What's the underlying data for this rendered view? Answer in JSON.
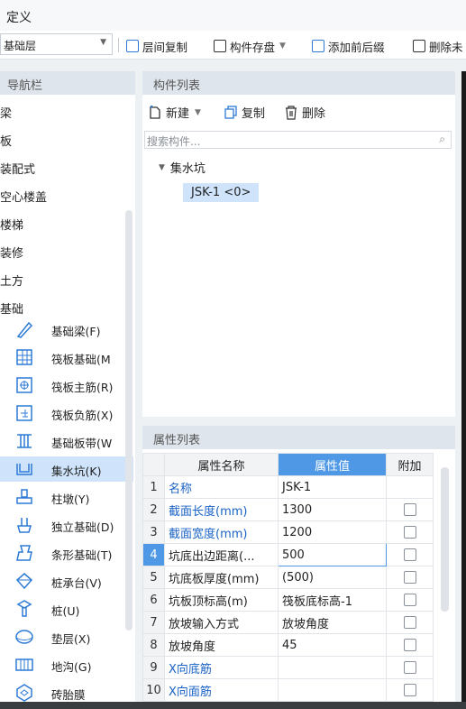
{
  "menu": {
    "title": "定义"
  },
  "toolbar": {
    "layer": "基础层",
    "buttons": [
      "层间复制",
      "构件存盘",
      "添加前后缀",
      "删除未"
    ]
  },
  "nav": {
    "title": "导航栏",
    "categories": [
      "梁",
      "板",
      "装配式",
      "空心楼盖",
      "楼梯",
      "装修",
      "土方",
      "基础"
    ],
    "subitems": [
      {
        "label": "基础梁(F)",
        "icon": "foundation-beam-icon"
      },
      {
        "label": "筏板基础(M",
        "icon": "raft-foundation-icon"
      },
      {
        "label": "筏板主筋(R)",
        "icon": "raft-main-rebar-icon"
      },
      {
        "label": "筏板负筋(X)",
        "icon": "raft-negative-rebar-icon"
      },
      {
        "label": "基础板带(W",
        "icon": "foundation-strip-icon"
      },
      {
        "label": "集水坑(K)",
        "icon": "sump-pit-icon"
      },
      {
        "label": "柱墩(Y)",
        "icon": "column-pier-icon"
      },
      {
        "label": "独立基础(D)",
        "icon": "isolated-footing-icon"
      },
      {
        "label": "条形基础(T)",
        "icon": "strip-footing-icon"
      },
      {
        "label": "桩承台(V)",
        "icon": "pile-cap-icon"
      },
      {
        "label": "桩(U)",
        "icon": "pile-icon"
      },
      {
        "label": "垫层(X)",
        "icon": "cushion-layer-icon"
      },
      {
        "label": "地沟(G)",
        "icon": "trench-icon"
      },
      {
        "label": "砖胎膜",
        "icon": "brick-mold-icon"
      }
    ]
  },
  "components": {
    "title": "构件列表",
    "new_label": "新建",
    "copy_label": "复制",
    "delete_label": "删除",
    "search_placeholder": "搜索构件...",
    "group": "集水坑",
    "item": "JSK-1 <0>"
  },
  "properties": {
    "title": "属性列表",
    "headers": [
      "属性名称",
      "属性值",
      "附加"
    ],
    "rows": [
      {
        "num": "1",
        "name": "名称",
        "value": "JSK-1"
      },
      {
        "num": "2",
        "name": "截面长度(mm)",
        "value": "1300"
      },
      {
        "num": "3",
        "name": "截面宽度(mm)",
        "value": "1200"
      },
      {
        "num": "4",
        "name": "坑底出边距离(...",
        "value": "500"
      },
      {
        "num": "5",
        "name": "坑底板厚度(mm)",
        "value": "(500)"
      },
      {
        "num": "6",
        "name": "坑板顶标高(m)",
        "value": "筏板底标高-1"
      },
      {
        "num": "7",
        "name": "放坡输入方式",
        "value": "放坡角度"
      },
      {
        "num": "8",
        "name": "放坡角度",
        "value": "45"
      },
      {
        "num": "9",
        "name": "X向底筋",
        "value": ""
      },
      {
        "num": "10",
        "name": "X向面筋",
        "value": ""
      }
    ]
  },
  "colors": {
    "accent": "#4e98e6",
    "selected_bg": "#cfe4fb",
    "link": "#1b63c6"
  }
}
